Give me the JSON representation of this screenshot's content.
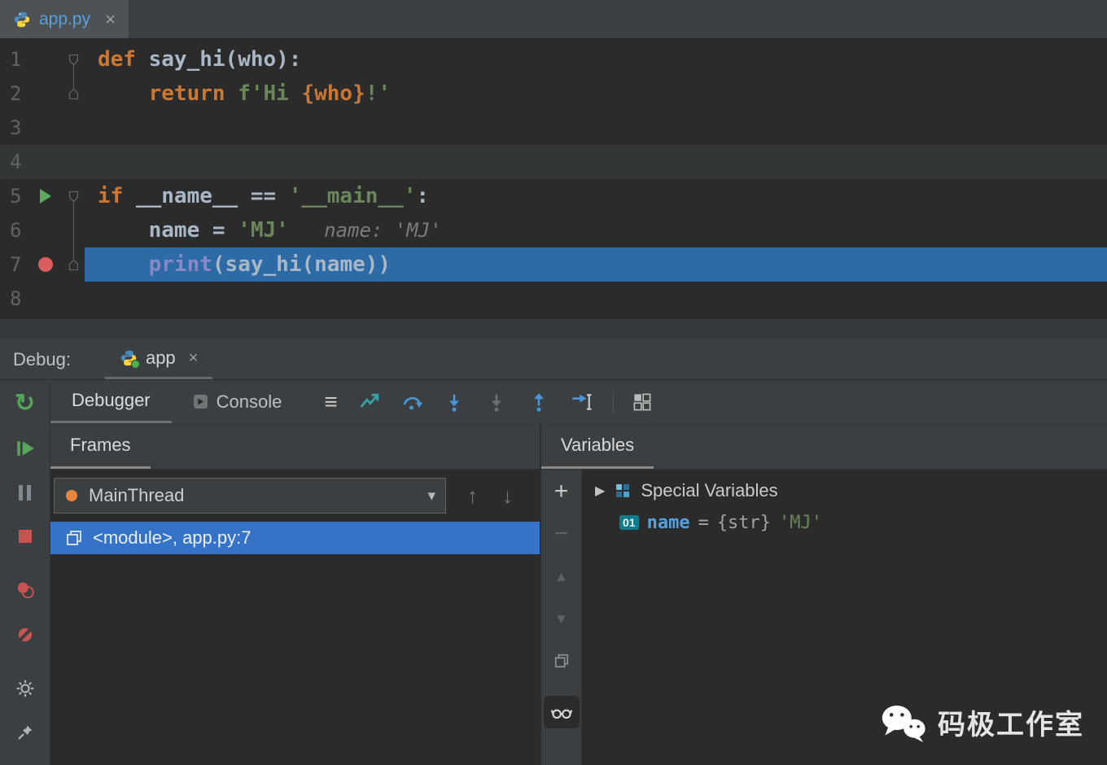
{
  "editor_tab": {
    "label": "app.py"
  },
  "editor": {
    "lines": [
      {
        "num": "1",
        "tokens": [
          {
            "t": "def ",
            "c": "kw"
          },
          {
            "t": "say_hi(who):",
            "c": "plain"
          }
        ]
      },
      {
        "num": "2",
        "tokens": [
          {
            "t": "    return ",
            "c": "kw"
          },
          {
            "t": "f'Hi ",
            "c": "str"
          },
          {
            "t": "{who}",
            "c": "fstr"
          },
          {
            "t": "!'",
            "c": "str"
          }
        ]
      },
      {
        "num": "3",
        "tokens": []
      },
      {
        "num": "4",
        "tokens": []
      },
      {
        "num": "5",
        "tokens": [
          {
            "t": "if ",
            "c": "kw"
          },
          {
            "t": "__name__ == ",
            "c": "plain"
          },
          {
            "t": "'__main__'",
            "c": "str"
          },
          {
            "t": ":",
            "c": "plain"
          }
        ]
      },
      {
        "num": "6",
        "tokens": [
          {
            "t": "    name = ",
            "c": "plain"
          },
          {
            "t": "'MJ'",
            "c": "str"
          },
          {
            "t": "   name: 'MJ'",
            "c": "hint"
          }
        ]
      },
      {
        "num": "7",
        "tokens": [
          {
            "t": "    ",
            "c": "plain"
          },
          {
            "t": "print",
            "c": "builtin"
          },
          {
            "t": "(say_hi(name))",
            "c": "plain"
          }
        ]
      },
      {
        "num": "8",
        "tokens": []
      }
    ]
  },
  "debug": {
    "label": "Debug:",
    "session_tab": {
      "label": "app"
    },
    "view_tabs": {
      "debugger": "Debugger",
      "console": "Console"
    },
    "frames": {
      "title": "Frames",
      "thread_selector": {
        "value": "MainThread"
      },
      "frame_list": [
        {
          "label": "<module>, app.py:7",
          "selected": true
        }
      ]
    },
    "variables": {
      "title": "Variables",
      "group_row": {
        "label": "Special Variables"
      },
      "var_row": {
        "badge": "01",
        "name": "name",
        "eq": " = ",
        "type": "{str}",
        "value": "'MJ'"
      }
    }
  },
  "icons": {
    "close": "×",
    "hamburger": "≡",
    "chevron_down": "▾",
    "up_arrow": "↑",
    "down_arrow": "↓",
    "plus": "+",
    "minus": "−",
    "tri_up": "▲",
    "tri_down": "▼",
    "rerun": "↻",
    "expand": "▶"
  },
  "watermark": {
    "text": "码极工作室"
  },
  "colors": {
    "execution_line_blue": "#2d6ba6",
    "frame_selection_blue": "#3573c9",
    "breakpoint_red": "#db5c5c",
    "run_green": "#5ca85c",
    "keyword_orange": "#cc7832",
    "string_green": "#6a8759",
    "thread_dot_orange": "#e8853c",
    "panel_grey": "#3c3f41",
    "editor_bg": "#2b2b2b"
  }
}
